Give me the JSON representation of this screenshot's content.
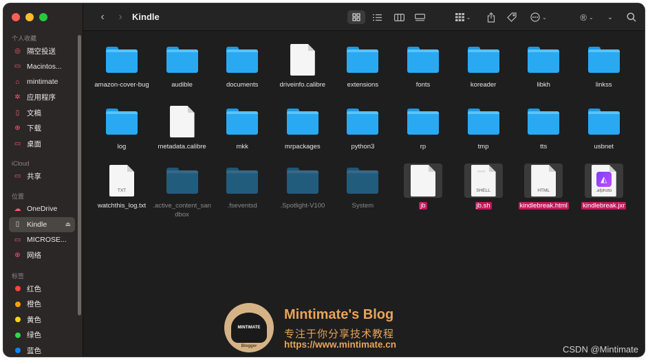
{
  "window": {
    "title": "Kindle"
  },
  "sidebar": {
    "sections": [
      {
        "heading": "个人收藏",
        "items": [
          {
            "label": "隔空投送",
            "icon": "airdrop-icon",
            "glyph": "◎"
          },
          {
            "label": "Macintos...",
            "icon": "harddisk-icon",
            "glyph": "▭"
          },
          {
            "label": "mintimate",
            "icon": "home-icon",
            "glyph": "⌂"
          },
          {
            "label": "应用程序",
            "icon": "applications-icon",
            "glyph": "✲"
          },
          {
            "label": "文稿",
            "icon": "document-icon",
            "glyph": "▯"
          },
          {
            "label": "下载",
            "icon": "download-icon",
            "glyph": "⊕"
          },
          {
            "label": "桌面",
            "icon": "desktop-icon",
            "glyph": "▭"
          }
        ]
      },
      {
        "heading": "iCloud",
        "items": [
          {
            "label": "共享",
            "icon": "shared-folder-icon",
            "glyph": "▭"
          }
        ]
      },
      {
        "heading": "位置",
        "items": [
          {
            "label": "OneDrive",
            "icon": "cloud-icon",
            "glyph": "☁"
          },
          {
            "label": "Kindle",
            "icon": "device-icon",
            "glyph": "▯",
            "selected": true
          },
          {
            "label": "MICROSE...",
            "icon": "monitor-icon",
            "glyph": "▭"
          },
          {
            "label": "网络",
            "icon": "network-icon",
            "glyph": "⊕"
          }
        ]
      },
      {
        "heading": "标签",
        "tags": [
          {
            "label": "红色",
            "color": "#ff453a"
          },
          {
            "label": "橙色",
            "color": "#ff9f0a"
          },
          {
            "label": "黄色",
            "color": "#ffd60a"
          },
          {
            "label": "绿色",
            "color": "#32d74b"
          },
          {
            "label": "蓝色",
            "color": "#0a84ff"
          }
        ]
      }
    ]
  },
  "files": [
    {
      "name": "amazon-cover-bug",
      "type": "folder"
    },
    {
      "name": "audible",
      "type": "folder"
    },
    {
      "name": "documents",
      "type": "folder"
    },
    {
      "name": "driveinfo.calibre",
      "type": "doc"
    },
    {
      "name": "extensions",
      "type": "folder"
    },
    {
      "name": "fonts",
      "type": "folder"
    },
    {
      "name": "koreader",
      "type": "folder"
    },
    {
      "name": "libkh",
      "type": "folder"
    },
    {
      "name": "linkss",
      "type": "folder"
    },
    {
      "name": "log",
      "type": "folder"
    },
    {
      "name": "metadata.calibre",
      "type": "doc"
    },
    {
      "name": "mkk",
      "type": "folder"
    },
    {
      "name": "mrpackages",
      "type": "folder"
    },
    {
      "name": "python3",
      "type": "folder"
    },
    {
      "name": "rp",
      "type": "folder"
    },
    {
      "name": "tmp",
      "type": "folder"
    },
    {
      "name": "tts",
      "type": "folder"
    },
    {
      "name": "usbnet",
      "type": "folder"
    },
    {
      "name": "watchthis_log.txt",
      "type": "doc",
      "label": "TXT"
    },
    {
      "name": ".active_content_sandbox",
      "type": "folder",
      "hidden": true
    },
    {
      "name": ".fseventsd",
      "type": "folder",
      "hidden": true
    },
    {
      "name": ".Spotlight-V100",
      "type": "folder",
      "hidden": true
    },
    {
      "name": "System",
      "type": "folder",
      "hidden": true
    },
    {
      "name": "jb",
      "type": "doc",
      "selected": true
    },
    {
      "name": "jb.sh",
      "type": "doc",
      "label": "SHELL",
      "selected": true,
      "lines": true
    },
    {
      "name": "kindlebreak.html",
      "type": "doc",
      "label": "HTML",
      "selected": true
    },
    {
      "name": "kindlebreak.jxr",
      "type": "doc",
      "label": ".afphoto",
      "selected": true,
      "afphoto": true
    }
  ],
  "watermark": {
    "logo_text": "MINTIMATE",
    "logo_sub": "Blogger",
    "title": "Mintimate's Blog",
    "subtitle": "专注于你分享技术教程",
    "url": "https://www.mintimate.cn"
  },
  "credit": "CSDN @Mintimate"
}
